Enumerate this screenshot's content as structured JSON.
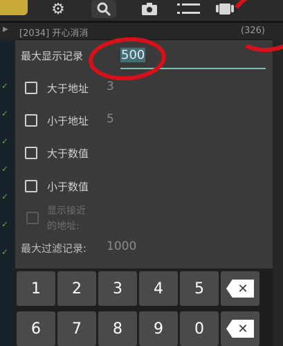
{
  "process": {
    "play_glyph": "▶",
    "name": "[2034] 开心消消",
    "count": "(326)"
  },
  "dialog": {
    "max_display_label": "最大显示记录",
    "max_display_value": "500",
    "greater_addr_label": "大于地址",
    "greater_addr_value": "3",
    "less_addr_label": "小于地址",
    "less_addr_value": "5",
    "greater_val_label": "大于数值",
    "less_val_label": "小于数值",
    "near_addr_label_1": "显示接近",
    "near_addr_label_2": "的地址:",
    "max_filter_label": "最大过滤记录:",
    "max_filter_value": "1000"
  },
  "keypad": {
    "row1": [
      "1",
      "2",
      "3",
      "4",
      "5"
    ],
    "row2": [
      "6",
      "7",
      "8",
      "9",
      "0"
    ],
    "backspace_glyph": "✕"
  },
  "colors": {
    "annotation_red": "#d8101a",
    "input_underline": "#7fbfb4",
    "selection": "#3f6f78"
  },
  "icons": [
    "gear-icon",
    "search-icon",
    "camera-icon",
    "menu-icon",
    "android-icon",
    "backspace-icon",
    "checkbox-icon"
  ]
}
